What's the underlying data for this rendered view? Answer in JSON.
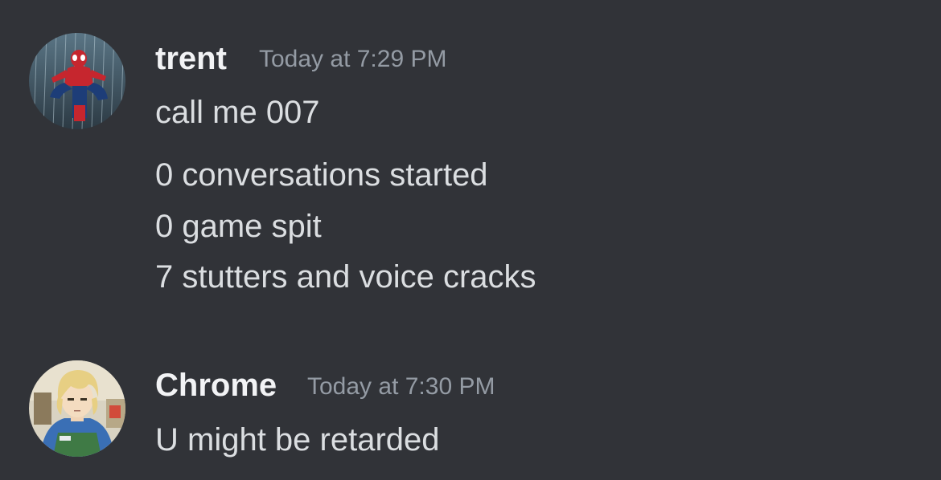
{
  "messages": [
    {
      "username": "trent",
      "timestamp": "Today at 7:29 PM",
      "avatar_icon": "spider-man-avatar",
      "lines": [
        "call me 007",
        "0 conversations started",
        "0 game spit",
        "7 stutters and voice cracks"
      ]
    },
    {
      "username": "Chrome",
      "timestamp": "Today at 7:30 PM",
      "avatar_icon": "anime-character-avatar",
      "lines": [
        "U might be retarded"
      ]
    }
  ],
  "colors": {
    "background": "#313338",
    "username": "#f2f3f5",
    "timestamp": "#949ba4",
    "message_text": "#dbdee1"
  }
}
